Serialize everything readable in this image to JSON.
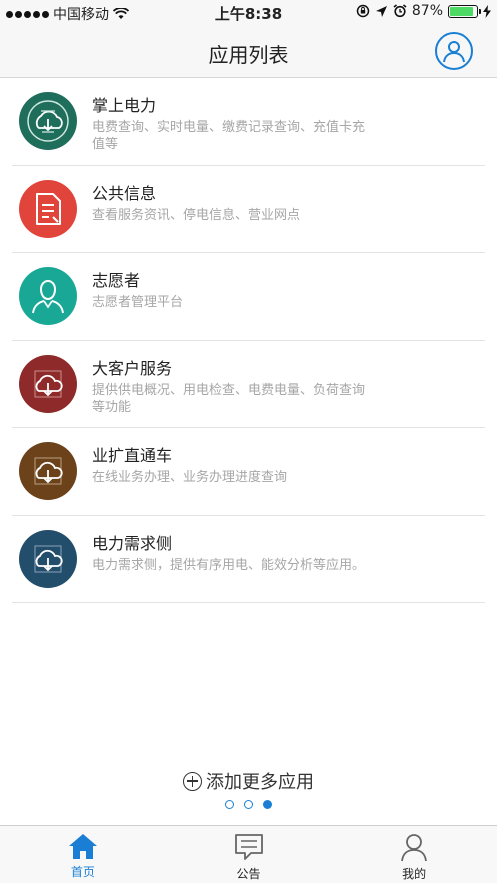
{
  "status_bar": {
    "carrier": "中国移动",
    "time": "上午8:38",
    "battery": "87%",
    "battery_level": 0.87
  },
  "header": {
    "title": "应用列表",
    "profile_icon": "user-circle-icon"
  },
  "apps": [
    {
      "name": "掌上电力",
      "desc": "电费查询、实时电量、缴费记录查询、充值卡充值等",
      "color": "#1f6d5b",
      "icon": "logo-emblem-icon"
    },
    {
      "name": "公共信息",
      "desc": "查看服务资讯、停电信息、营业网点",
      "color": "#e0443a",
      "icon": "document-icon"
    },
    {
      "name": "志愿者",
      "desc": "志愿者管理平台",
      "color": "#1aa896",
      "icon": "person-outline-icon"
    },
    {
      "name": "大客户服务",
      "desc": "提供供电概况、用电检查、电费电量、负荷查询等功能",
      "color": "#8e2a2a",
      "icon": "cloud-arrow-icon"
    },
    {
      "name": "业扩直通车",
      "desc": "在线业务办理、业务办理进度查询",
      "color": "#6b4219",
      "icon": "cloud-arrow-icon"
    },
    {
      "name": "电力需求侧",
      "desc": "电力需求侧，提供有序用电、能效分析等应用。",
      "color": "#224d6b",
      "icon": "cloud-arrow-icon"
    }
  ],
  "add_more": {
    "label": "添加更多应用"
  },
  "pager": {
    "count": 3,
    "active": 2
  },
  "tabs": [
    {
      "label": "首页",
      "icon": "home-icon",
      "active": true
    },
    {
      "label": "公告",
      "icon": "message-icon",
      "active": false
    },
    {
      "label": "我的",
      "icon": "person-icon",
      "active": false
    }
  ],
  "colors": {
    "accent": "#1a7fd4",
    "battery": "#4cd964"
  }
}
